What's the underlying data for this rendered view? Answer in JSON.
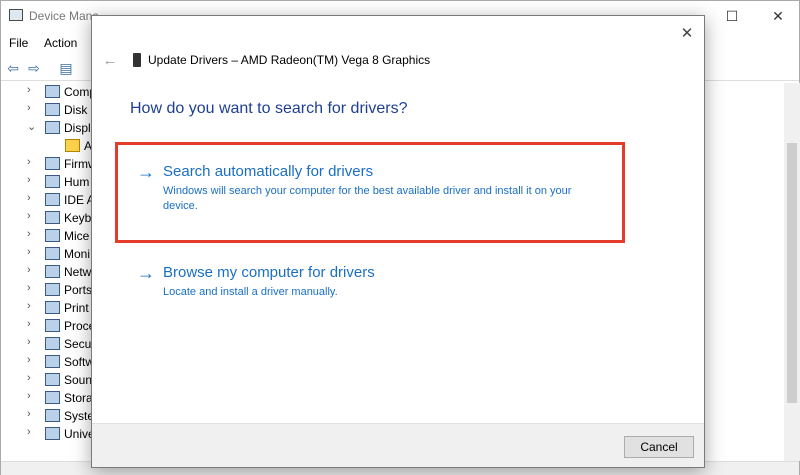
{
  "device_manager": {
    "title": "Device Mana",
    "caption_buttons": {
      "minimize": "—",
      "maximize": "☐",
      "close": "✕"
    },
    "menu": [
      {
        "label": "File"
      },
      {
        "label": "Action"
      }
    ],
    "tree": [
      {
        "label": "Comp",
        "expanded": false
      },
      {
        "label": "Disk d",
        "expanded": false
      },
      {
        "label": "Displa",
        "expanded": true
      },
      {
        "label": "A",
        "child": true,
        "icon": "warning-icon"
      },
      {
        "label": "Firmw",
        "expanded": false
      },
      {
        "label": "Hum",
        "expanded": false
      },
      {
        "label": "IDE A",
        "expanded": false
      },
      {
        "label": "Keybo",
        "expanded": false
      },
      {
        "label": "Mice",
        "expanded": false
      },
      {
        "label": "Moni",
        "expanded": false
      },
      {
        "label": "Netw",
        "expanded": false
      },
      {
        "label": "Ports",
        "expanded": false
      },
      {
        "label": "Print",
        "expanded": false
      },
      {
        "label": "Proce",
        "expanded": false
      },
      {
        "label": "Secur",
        "expanded": false
      },
      {
        "label": "Softw",
        "expanded": false
      },
      {
        "label": "Soun",
        "expanded": false
      },
      {
        "label": "Stora",
        "expanded": false
      },
      {
        "label": "Syste",
        "expanded": false
      },
      {
        "label": "Unive",
        "expanded": false
      }
    ]
  },
  "dialog": {
    "title": "Update Drivers – AMD Radeon(TM) Vega 8 Graphics",
    "question": "How do you want to search for drivers?",
    "options": {
      "auto": {
        "title": "Search automatically for drivers",
        "description": "Windows will search your computer for the best available driver and install it on your device."
      },
      "browse": {
        "title": "Browse my computer for drivers",
        "description": "Locate and install a driver manually."
      }
    },
    "cancel_label": "Cancel",
    "close_glyph": "✕",
    "back_glyph": "←",
    "arrow_glyph": "→"
  },
  "colors": {
    "link": "#1a6fc4",
    "heading": "#1e3f91",
    "highlight": "#e43b2b"
  }
}
